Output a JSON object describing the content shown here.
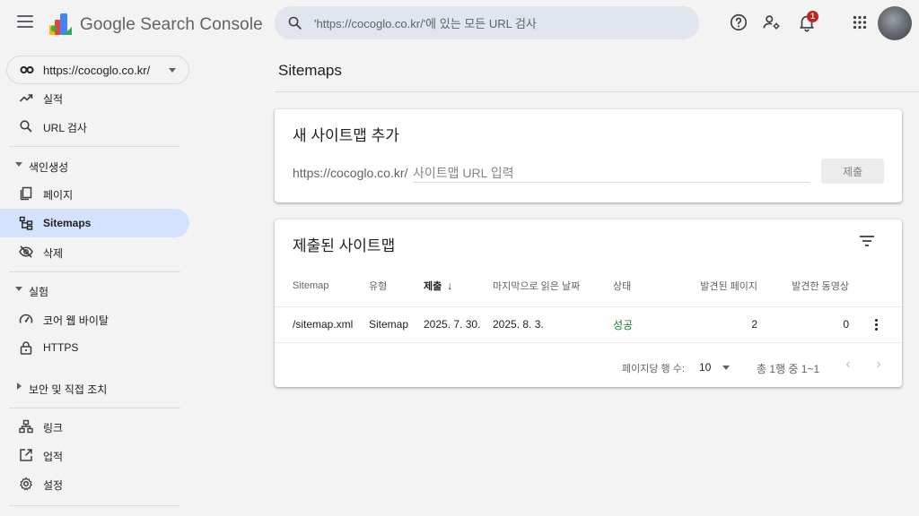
{
  "header": {
    "brand": "Google Search Console",
    "search_placeholder": "'https://cocoglo.co.kr/'에 있는 모든 URL 검사",
    "notification_count": "1"
  },
  "sidebar": {
    "property": "https://cocoglo.co.kr/",
    "items_top": [
      {
        "label": "실적",
        "icon": "trending-up-icon"
      },
      {
        "label": "URL 검사",
        "icon": "search-icon"
      }
    ],
    "section_indexing": "색인생성",
    "items_indexing": [
      {
        "label": "페이지",
        "icon": "pages-icon"
      },
      {
        "label": "Sitemaps",
        "icon": "sitemap-icon",
        "active": true
      },
      {
        "label": "삭제",
        "icon": "visibility-off-icon"
      }
    ],
    "section_experience": "실험",
    "items_experience": [
      {
        "label": "코어 웹 바이탈",
        "icon": "speed-icon"
      },
      {
        "label": "HTTPS",
        "icon": "lock-icon"
      }
    ],
    "section_security": "보안 및 직접 조치",
    "items_bottom": [
      {
        "label": "링크",
        "icon": "links-icon"
      },
      {
        "label": "업적",
        "icon": "open-in-new-icon"
      },
      {
        "label": "설정",
        "icon": "gear-icon"
      }
    ]
  },
  "main": {
    "page_title": "Sitemaps",
    "add_card": {
      "title": "새 사이트맵 추가",
      "prefix": "https://cocoglo.co.kr/",
      "input_placeholder": "사이트맵 URL 입력",
      "submit_label": "제출"
    },
    "submitted_card": {
      "title": "제출된 사이트맵",
      "columns": [
        "Sitemap",
        "유형",
        "제출",
        "마지막으로 읽은 날짜",
        "상태",
        "발견된 페이지",
        "발견한 동영상"
      ],
      "sorted_arrow": "↓",
      "rows": [
        {
          "sitemap": "/sitemap.xml",
          "type": "Sitemap",
          "submitted": "2025. 7. 30.",
          "last_read": "2025. 8. 3.",
          "status": "성공",
          "pages": "2",
          "videos": "0"
        }
      ],
      "pager": {
        "rows_per_page_label": "페이지당 행 수:",
        "rows_per_page": "10",
        "range": "총 1행 중 1~1",
        "prev": "‹",
        "next": "›"
      }
    }
  },
  "colors": {
    "accent": "#d3e3fd",
    "success": "#188038",
    "badge": "#c5221f"
  }
}
